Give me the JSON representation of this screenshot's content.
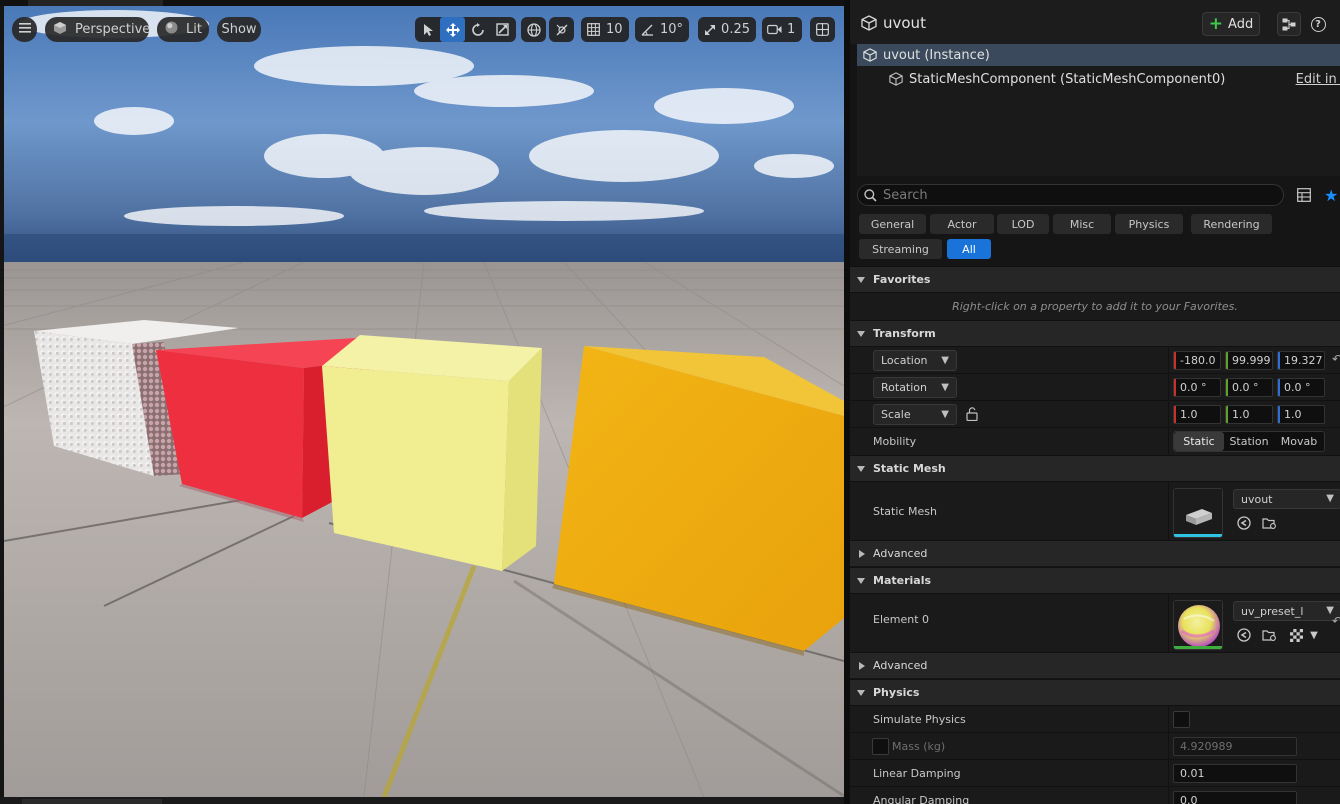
{
  "viewport": {
    "view_mode": "Perspective",
    "lighting": "Lit",
    "show": "Show",
    "grid_snap": "10",
    "rotation_snap": "10°",
    "scale_snap": "0.25",
    "camera_speed": "1"
  },
  "details": {
    "actor_name": "uvout",
    "add_label": "Add",
    "help_label": "?",
    "tree": {
      "root": "uvout (Instance)",
      "child": "StaticMeshComponent (StaticMeshComponent0)",
      "edit_link": "Edit in C"
    },
    "search_placeholder": "Search",
    "filters": [
      "General",
      "Actor",
      "LOD",
      "Misc",
      "Physics",
      "Rendering",
      "Streaming",
      "All"
    ],
    "active_filter": "All",
    "favorites": {
      "title": "Favorites",
      "message": "Right-click on a property to add it to your Favorites."
    },
    "transform": {
      "title": "Transform",
      "location": {
        "label": "Location",
        "x": "-180.0",
        "y": "99.999",
        "z": "19.327"
      },
      "rotation": {
        "label": "Rotation",
        "x": "0.0 °",
        "y": "0.0 °",
        "z": "0.0 °"
      },
      "scale": {
        "label": "Scale",
        "x": "1.0",
        "y": "1.0",
        "z": "1.0"
      },
      "mobility": {
        "label": "Mobility",
        "options": [
          "Static",
          "Station",
          "Movab"
        ],
        "selected": "Static"
      }
    },
    "static_mesh": {
      "title": "Static Mesh",
      "label": "Static Mesh",
      "asset": "uvout",
      "advanced": "Advanced"
    },
    "materials": {
      "title": "Materials",
      "element_label": "Element 0",
      "asset": "uv_preset_l",
      "advanced": "Advanced"
    },
    "physics": {
      "title": "Physics",
      "simulate_label": "Simulate Physics",
      "mass_label": "Mass (kg)",
      "mass_value": "4.920989",
      "linear_damping_label": "Linear Damping",
      "linear_damping_value": "0.01",
      "angular_damping_label": "Angular Damping",
      "angular_damping_value": "0.0"
    }
  },
  "colors": {
    "accent": "#1a73d9",
    "x_axis": "#c8322b",
    "y_axis": "#5fa32c",
    "z_axis": "#2d6fd6",
    "mesh_underline": "#2fc3e6",
    "material_underline": "#3fae3f"
  }
}
